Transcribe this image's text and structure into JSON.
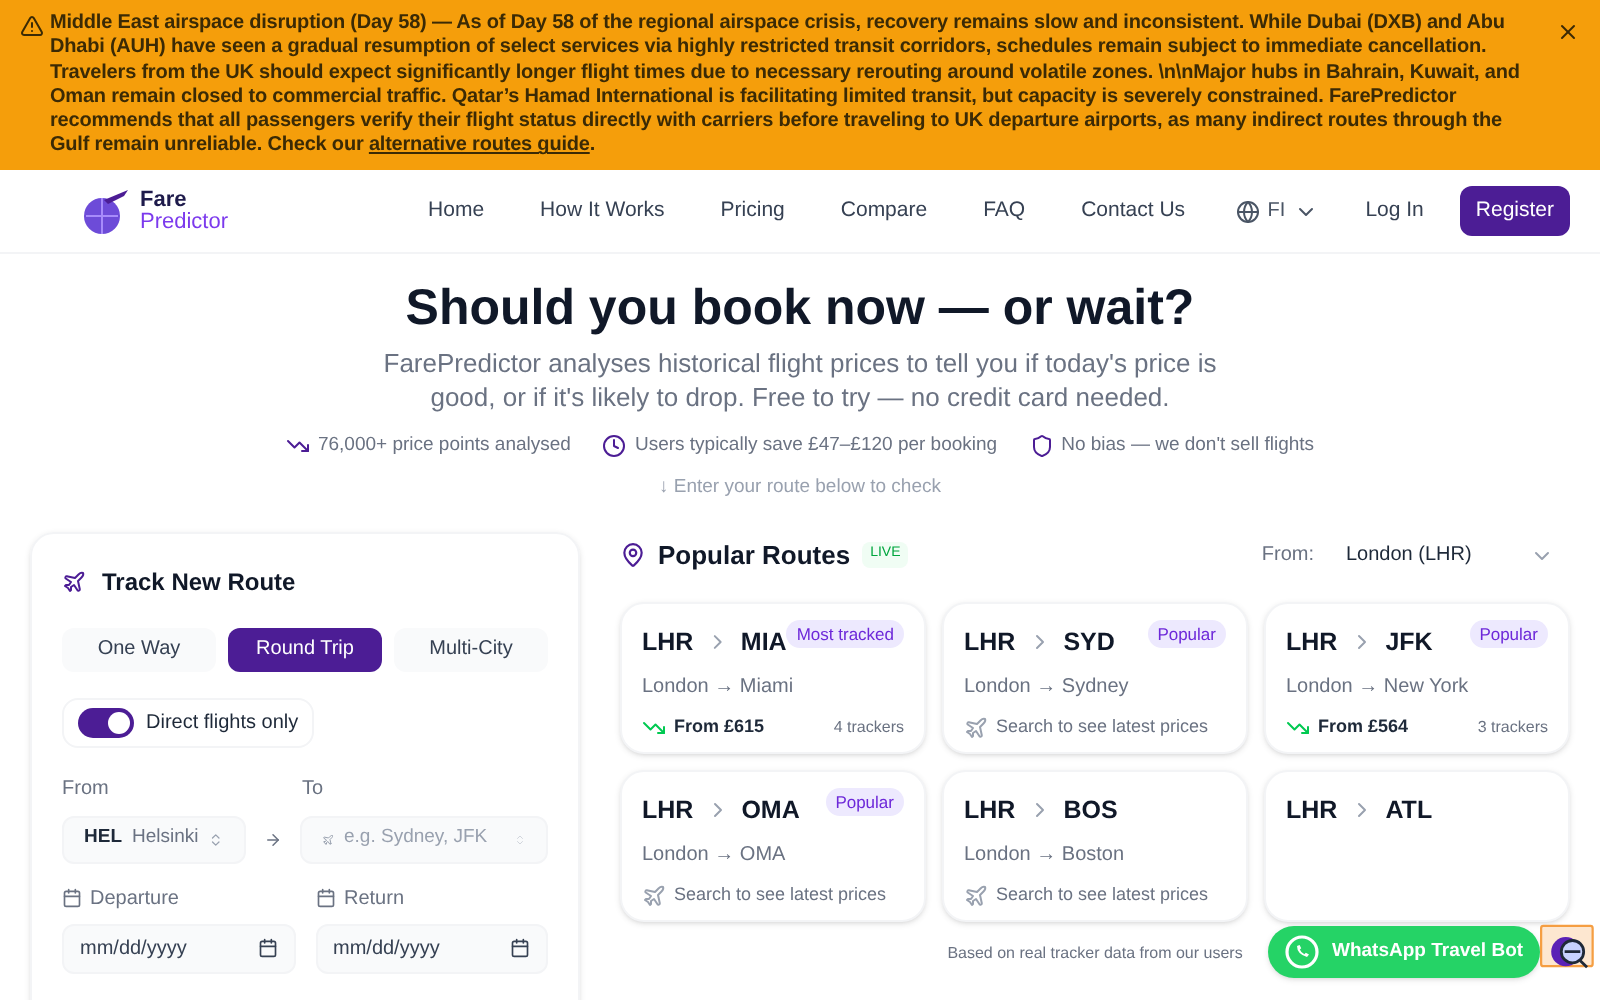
{
  "banner": {
    "text": "**Middle East airspace disruption (Day 58)** — As of Day 58 of the regional airspace crisis, recovery remains slow and inconsistent. While Dubai (DXB) and Abu Dhabi (AUH) have seen a gradual resumption of select services via highly restricted transit corridors, schedules remain subject to immediate cancellation. Travelers from the UK should expect significantly longer flight times due to necessary rerouting around volatile zones. \\n\\nMajor hubs in Bahrain, Kuwait, and Oman remain closed to commercial traffic. Qatar’s Hamad International is facilitating limited transit, but capacity is severely constrained. FarePredictor recommends that all passengers verify their flight status directly with carriers before traveling to UK departure airports, as many indirect routes through the Gulf remain unreliable. Check our",
    "link": "alternative routes guide",
    "end": "."
  },
  "logo": {
    "line1": "Fare",
    "line2": "Predictor"
  },
  "nav": [
    "Home",
    "How It Works",
    "Pricing",
    "Compare",
    "FAQ",
    "Contact Us"
  ],
  "language": "FI",
  "login": "Log In",
  "register": "Register",
  "hero": {
    "title": "Should you book now — or wait?",
    "subtitle": "FarePredictor analyses historical flight prices to tell you if today's price is good, or if it's likely to drop. Free to try — no credit card needed.",
    "facts": [
      {
        "kind": "trend",
        "text": "76,000+ price points analysed"
      },
      {
        "kind": "clock",
        "text": "Users typically save £47–£120 per booking"
      },
      {
        "kind": "shield",
        "text": "No bias — we don't sell flights"
      }
    ],
    "hint": "↓ Enter your route below to check"
  },
  "track": {
    "title": "Track New Route",
    "trip_types": [
      {
        "label": "One Way",
        "selected": false
      },
      {
        "label": "Round Trip",
        "selected": true
      },
      {
        "label": "Multi-City",
        "selected": false
      }
    ],
    "direct": {
      "label": "Direct flights only",
      "on": true
    },
    "from_label": "From",
    "to_label": "To",
    "from": {
      "code": "HEL",
      "city": "Helsinki"
    },
    "to": {
      "placeholder": "e.g. Sydney, JFK"
    },
    "departure_label": "Departure",
    "return_label": "Return",
    "departure": {
      "placeholder": "mm/dd/yyyy"
    },
    "return": {
      "placeholder": "mm/dd/yyyy"
    }
  },
  "popular": {
    "title": "Popular Routes",
    "live": "LIVE",
    "from_label": "From:",
    "from_value": "London (LHR)",
    "routes": [
      {
        "origin": "LHR",
        "dest": "MIA",
        "badge": "Most tracked",
        "sub": "London → Miami",
        "kind": "price",
        "price": "From £615",
        "trackers": "4 trackers"
      },
      {
        "origin": "LHR",
        "dest": "SYD",
        "badge": "Popular",
        "sub": "London → Sydney",
        "kind": "search",
        "hint": "Search to see latest prices"
      },
      {
        "origin": "LHR",
        "dest": "JFK",
        "badge": "Popular",
        "sub": "London → New York",
        "kind": "price",
        "price": "From £564",
        "trackers": "3 trackers"
      },
      {
        "origin": "LHR",
        "dest": "OMA",
        "badge": "Popular",
        "sub": "London → OMA",
        "kind": "search",
        "hint": "Search to see latest prices"
      },
      {
        "origin": "LHR",
        "dest": "BOS",
        "sub": "London → Boston",
        "kind": "search",
        "hint": "Search to see latest prices"
      },
      {
        "origin": "LHR",
        "dest": "ATL",
        "kind": "search"
      }
    ],
    "footnote": "Based on real tracker data from our users"
  },
  "whatsapp": "WhatsApp Travel Bot"
}
